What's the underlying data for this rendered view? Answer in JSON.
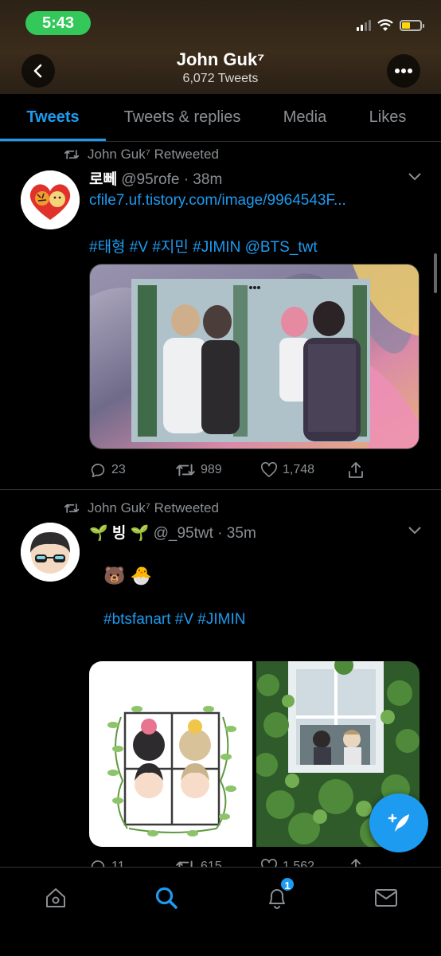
{
  "status_bar": {
    "time": "5:43"
  },
  "header": {
    "name": "John Guk⁷",
    "tweet_count": "6,072 Tweets"
  },
  "tabs": [
    {
      "label": "Tweets",
      "active": true
    },
    {
      "label": "Tweets & replies",
      "active": false
    },
    {
      "label": "Media",
      "active": false
    },
    {
      "label": "Likes",
      "active": false
    }
  ],
  "tweets": [
    {
      "retweeted_by": "John Guk⁷ Retweeted",
      "display_name": "로뻬",
      "handle": "@95rofe",
      "time": "· 38m",
      "link": "cfile7.uf.tistory.com/image/9964543F...",
      "hashtags": "#태형 #V #지민 #JIMIN @BTS_twt",
      "replies": "23",
      "retweets": "989",
      "likes": "1,748"
    },
    {
      "retweeted_by": "John Guk⁷ Retweeted",
      "display_name": "🌱 빙 🌱",
      "handle": "@_95twt",
      "time": "· 35m",
      "emoji_line": "🐻 🐣",
      "hashtags": "#btsfanart #V #JIMIN",
      "replies": "11",
      "retweets": "615",
      "likes": "1,562"
    }
  ],
  "notifications_badge": "1",
  "colors": {
    "accent": "#1d9bf0",
    "background": "#000000",
    "status_time_bg": "#34c759"
  },
  "icons": [
    "back-icon",
    "more-icon",
    "retweet-icon",
    "caret-down-icon",
    "reply-icon",
    "like-icon",
    "share-icon",
    "compose-icon",
    "home-icon",
    "search-icon",
    "bell-icon",
    "mail-icon"
  ]
}
